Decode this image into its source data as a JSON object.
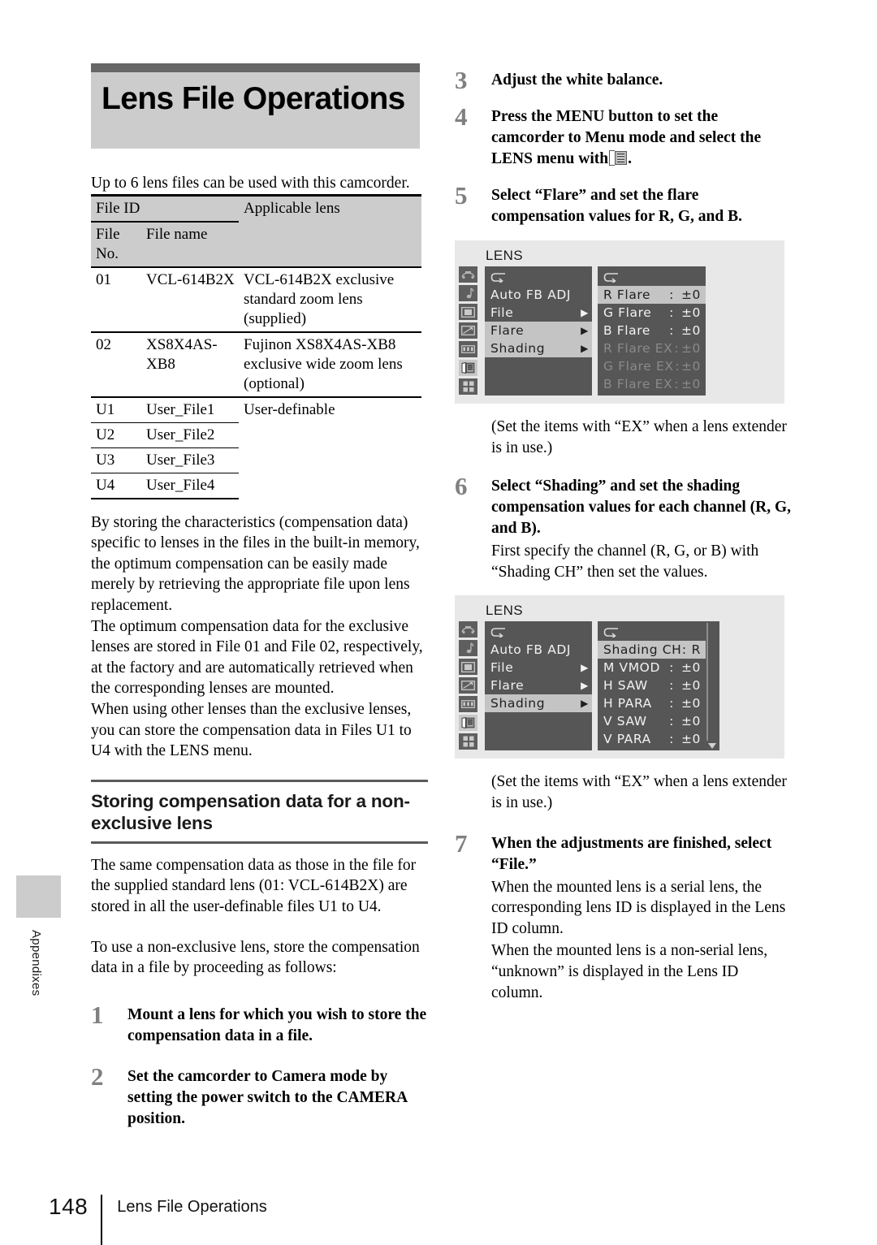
{
  "page": {
    "number": "148",
    "footer_title": "Lens File Operations",
    "side_tab": "Appendixes"
  },
  "left": {
    "title": "Lens File Operations",
    "intro": "Up to 6 lens files can be used with this camcorder.",
    "table": {
      "group_header_left": "File ID",
      "group_header_right": "Applicable lens",
      "sub_header_no": "File No.",
      "sub_header_name": "File name",
      "rows": [
        {
          "no": "01",
          "name": "VCL-614B2X",
          "lens": "VCL-614B2X exclusive standard zoom lens (supplied)"
        },
        {
          "no": "02",
          "name": "XS8X4AS-XB8",
          "lens": "Fujinon XS8X4AS-XB8 exclusive wide zoom lens (optional)"
        },
        {
          "no": "U1",
          "name": "User_File1",
          "lens": "User-definable"
        },
        {
          "no": "U2",
          "name": "User_File2",
          "lens": ""
        },
        {
          "no": "U3",
          "name": "User_File3",
          "lens": ""
        },
        {
          "no": "U4",
          "name": "User_File4",
          "lens": ""
        }
      ]
    },
    "para1": "By storing the characteristics (compensation data) specific to lenses in the files in the built-in memory, the optimum compensation can be easily made merely by retrieving the appropriate file upon lens replacement.",
    "para2": "The optimum compensation data for the exclusive lenses are stored in File 01 and File 02, respectively, at the factory and are automatically retrieved when the corresponding lenses are mounted.",
    "para3": "When using other lenses than the exclusive lenses, you can store the compensation data in Files U1 to U4 with the LENS menu.",
    "section_heading": "Storing compensation data for a non-exclusive lens",
    "para4": "The same compensation data as those in the file for the supplied standard lens (01: VCL-614B2X) are stored in all the user-definable files U1 to U4.",
    "para5": "To use a non-exclusive lens, store the compensation data in a file by proceeding as follows:",
    "step1": {
      "num": "1",
      "text": "Mount a lens for which you wish to store the compensation data in a file."
    },
    "step2": {
      "num": "2",
      "text": "Set the camcorder to Camera mode by setting the power switch to the CAMERA position."
    }
  },
  "right": {
    "step3": {
      "num": "3",
      "text": "Adjust the white balance."
    },
    "step4": {
      "num": "4",
      "text_before": "Press the MENU button to set the camcorder to Menu mode and select the LENS menu with",
      "text_after": "."
    },
    "step5": {
      "num": "5",
      "text": "Select “Flare” and set the flare compensation values for R, G, and B."
    },
    "note1": "(Set the items with “EX” when a lens extender is in use.)",
    "step6": {
      "num": "6",
      "text": "Select “Shading” and set the shading compensation values for each channel (R, G, and B).",
      "sub": "First specify the channel (R, G, or B) with “Shading CH” then set the values."
    },
    "note2": "(Set the items with “EX” when a lens extender is in use.)",
    "step7": {
      "num": "7",
      "text": "When the adjustments are finished, select “File.”",
      "sub1": "When the mounted lens is a serial lens, the corresponding lens ID is displayed in the Lens ID column.",
      "sub2": "When the mounted lens is a non-serial lens, “unknown” is displayed in the Lens ID column."
    },
    "osd_flare": {
      "title": "LENS",
      "back_label": "↵",
      "left_items": [
        {
          "label": "Auto FB ADJ",
          "arrow": "",
          "selected": false
        },
        {
          "label": "File",
          "arrow": "▶",
          "selected": false
        },
        {
          "label": "Flare",
          "arrow": "▶",
          "selected": true
        },
        {
          "label": "Shading",
          "arrow": "▶",
          "selected": true
        }
      ],
      "right_items": [
        {
          "label": "R Flare",
          "colon": ":",
          "value": "±0",
          "selected": true,
          "dim": false
        },
        {
          "label": "G Flare",
          "colon": ":",
          "value": "±0",
          "selected": false,
          "dim": false
        },
        {
          "label": "B Flare",
          "colon": ":",
          "value": "±0",
          "selected": false,
          "dim": false
        },
        {
          "label": "R Flare EX",
          "colon": ":",
          "value": "±0",
          "selected": false,
          "dim": true
        },
        {
          "label": "G Flare EX",
          "colon": ":",
          "value": "±0",
          "selected": false,
          "dim": true
        },
        {
          "label": "B Flare EX",
          "colon": ":",
          "value": "±0",
          "selected": false,
          "dim": true
        }
      ]
    },
    "osd_shading": {
      "title": "LENS",
      "left_items": [
        {
          "label": "Auto FB ADJ",
          "arrow": "",
          "selected": false
        },
        {
          "label": "File",
          "arrow": "▶",
          "selected": false
        },
        {
          "label": "Flare",
          "arrow": "▶",
          "selected": false
        },
        {
          "label": "Shading",
          "arrow": "▶",
          "selected": true
        }
      ],
      "right_items": [
        {
          "label": "Shading CH",
          "colon": ":",
          "value": "R",
          "selected": true,
          "dim": false
        },
        {
          "label": "M VMOD",
          "colon": ":",
          "value": "±0",
          "selected": false,
          "dim": false
        },
        {
          "label": "H SAW",
          "colon": ":",
          "value": "±0",
          "selected": false,
          "dim": false
        },
        {
          "label": "H PARA",
          "colon": ":",
          "value": "±0",
          "selected": false,
          "dim": false
        },
        {
          "label": "V SAW",
          "colon": ":",
          "value": "±0",
          "selected": false,
          "dim": false
        },
        {
          "label": "V PARA",
          "colon": ":",
          "value": "±0",
          "selected": false,
          "dim": false
        }
      ]
    }
  },
  "colors": {
    "banner_top": "#666666",
    "banner_body": "#cccccc",
    "osd_bg": "#e8e8e8",
    "osd_panel": "#565656",
    "osd_selected": "#c4c4c4",
    "step_number": "#808080"
  }
}
